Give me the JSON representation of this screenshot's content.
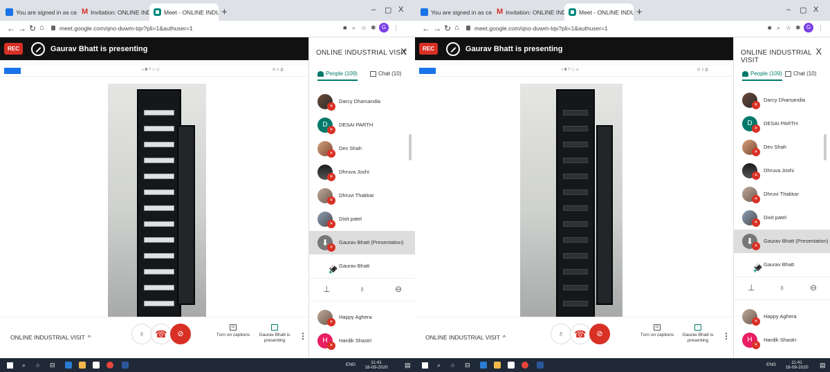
{
  "screens": [
    {
      "tabs": [
        "You are signed in as ce.dmm",
        "Invitation: ONLINE INDUSTRIAL",
        "Meet - ONLINE INDUSTRIAL"
      ],
      "url": "meet.google.com/qno-duwm-tqv?pli=1&authuser=1",
      "profile_initial": "G",
      "rec_label": "REC",
      "presenting_banner": "Gaurav Bhatt is presenting",
      "panel": {
        "title": "ONLINE INDUSTRIAL VISIT",
        "close": "X",
        "people_tab": "People (109)",
        "chat_tab": "Chat (10)"
      },
      "participants": [
        "Darcy Dharsandia",
        "DESAI PARTH",
        "Dev Shah",
        "Dhruva Joshi",
        "Dhruvi Thakkar",
        "Dixit patel",
        "Gaurav Bhatt (Presentation)",
        "Gaurav Bhatt"
      ],
      "participants_below": [
        "Happy Aghera",
        "Hardik Shastri"
      ],
      "initials": {
        "DESAI PARTH": "D",
        "Hardik Shastri": "H"
      },
      "meeting_name": "ONLINE INDUSTRIAL VISIT",
      "captions_label": "Turn on captions",
      "presenting_label": "Gaurav Bhatt is presenting",
      "tray": {
        "lang": "ENG",
        "time": "11:41",
        "date": "18-09-2020"
      }
    },
    {
      "tabs": [
        "You are signed in as ce.dmm",
        "Invitation: ONLINE INDUSTRIAL",
        "Meet - ONLINE INDUSTRIAL"
      ],
      "url": "meet.google.com/qno-duwm-tqv?pli=1&authuser=1",
      "profile_initial": "G",
      "rec_label": "REC",
      "presenting_banner": "Gaurav Bhatt is presenting",
      "panel": {
        "title": "ONLINE INDUSTRIAL VISIT",
        "close": "X",
        "people_tab": "People (109)",
        "chat_tab": "Chat (10)"
      },
      "participants": [
        "Darcy Dharsandia",
        "DESAI PARTH",
        "Dev Shah",
        "Dhruva Joshi",
        "Dhruvi Thakkar",
        "Dixit patel",
        "Gaurav Bhatt (Presentation)",
        "Gaurav Bhatt"
      ],
      "participants_below": [
        "Happy Aghera",
        "Hardik Shastri"
      ],
      "initials": {
        "DESAI PARTH": "D",
        "Hardik Shastri": "H"
      },
      "meeting_name": "ONLINE INDUSTRIAL VISIT",
      "captions_label": "Turn on captions",
      "presenting_label": "Gaurav Bhatt is presenting",
      "tray": {
        "lang": "ENG",
        "time": "11:41",
        "date": "18-09-2020"
      }
    }
  ],
  "colors": {
    "accent": "#00796b",
    "danger": "#d93025",
    "link": "#1a73e8"
  },
  "icons": [
    "tab-favicon",
    "gmail-icon",
    "meet-icon",
    "close-icon",
    "back-icon",
    "forward-icon",
    "reload-icon",
    "home-icon",
    "lock-icon",
    "star-icon",
    "people-icon",
    "chat-icon",
    "mic-icon",
    "end-call-icon",
    "camera-off-icon",
    "captions-icon",
    "present-icon",
    "more-icon",
    "pin-icon",
    "minus-icon",
    "windows-icon",
    "search-icon"
  ]
}
